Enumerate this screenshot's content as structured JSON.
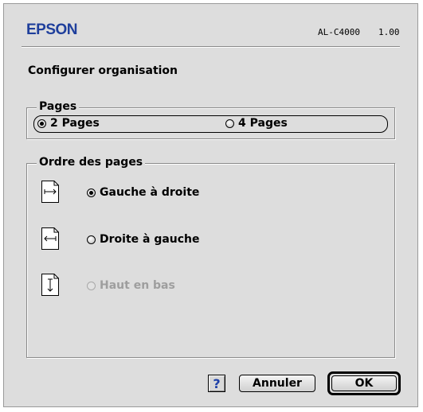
{
  "header": {
    "brand": "EPSON",
    "model": "AL-C4000",
    "version": "1.00"
  },
  "title": "Configurer organisation",
  "pages_group": {
    "label": "Pages",
    "options": [
      {
        "label": "2 Pages",
        "selected": true
      },
      {
        "label": "4 Pages",
        "selected": false
      }
    ]
  },
  "order_group": {
    "label": "Ordre des pages",
    "options": [
      {
        "label": "Gauche à droite",
        "selected": true,
        "enabled": true,
        "icon": "left-to-right-arrow-icon"
      },
      {
        "label": "Droite à gauche",
        "selected": false,
        "enabled": true,
        "icon": "right-to-left-arrow-icon"
      },
      {
        "label": "Haut en bas",
        "selected": false,
        "enabled": false,
        "icon": "top-to-bottom-arrow-icon"
      }
    ]
  },
  "buttons": {
    "help": "?",
    "cancel": "Annuler",
    "ok": "OK"
  },
  "colors": {
    "brand": "#1f3f9c",
    "dialog_bg": "#dddddd",
    "disabled_text": "#9e9e9e"
  }
}
